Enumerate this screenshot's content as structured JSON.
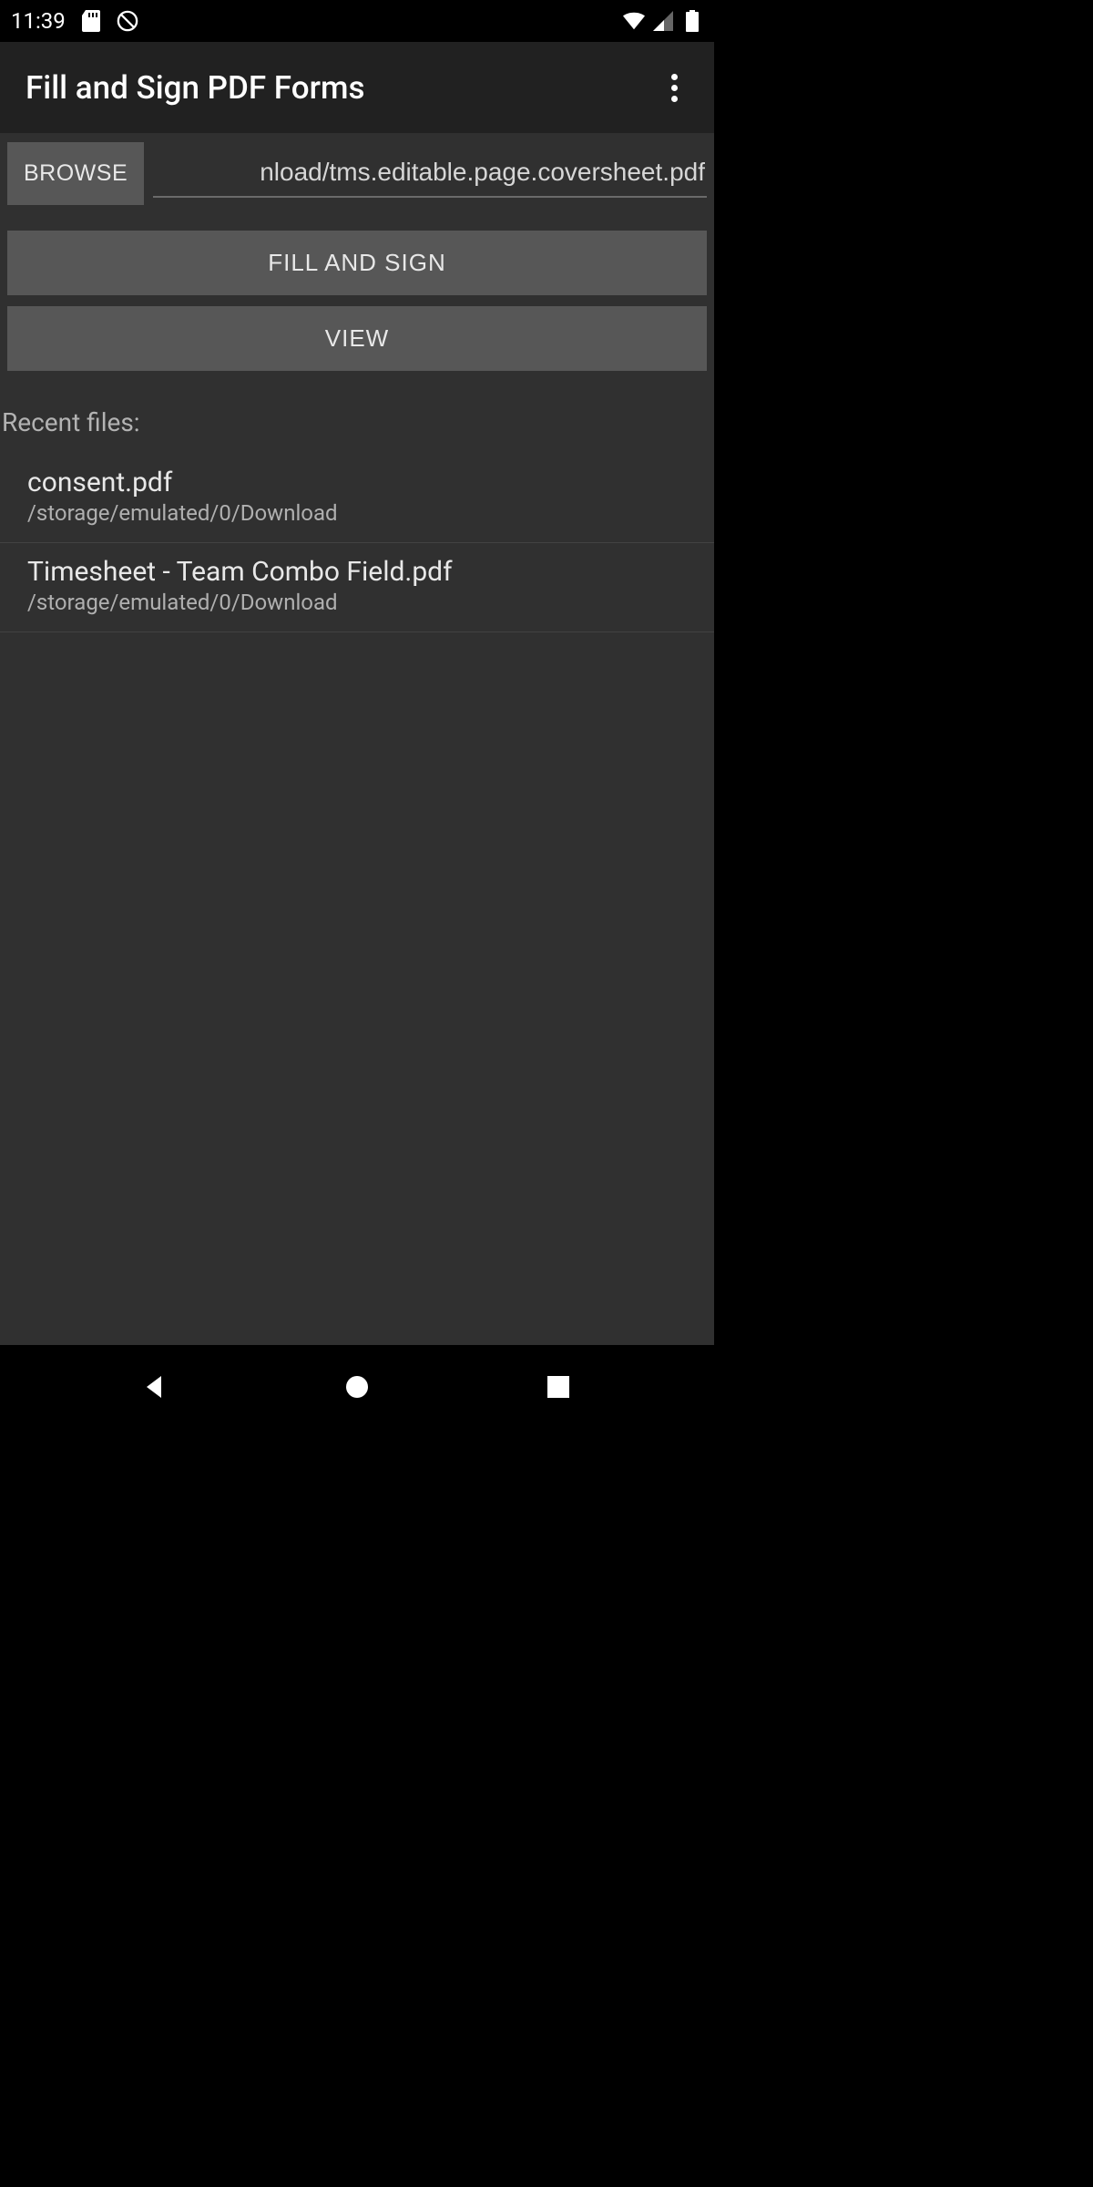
{
  "status": {
    "time": "11:39"
  },
  "header": {
    "title": "Fill and Sign PDF Forms"
  },
  "controls": {
    "browse_label": "BROWSE",
    "file_path_visible": "nload/tms.editable.page.coversheet.pdf",
    "fill_sign_label": "FILL AND SIGN",
    "view_label": "VIEW"
  },
  "recent": {
    "section_label": "Recent files:",
    "items": [
      {
        "name": "consent.pdf",
        "path": "/storage/emulated/0/Download"
      },
      {
        "name": "Timesheet - Team Combo Field.pdf",
        "path": "/storage/emulated/0/Download"
      }
    ]
  }
}
